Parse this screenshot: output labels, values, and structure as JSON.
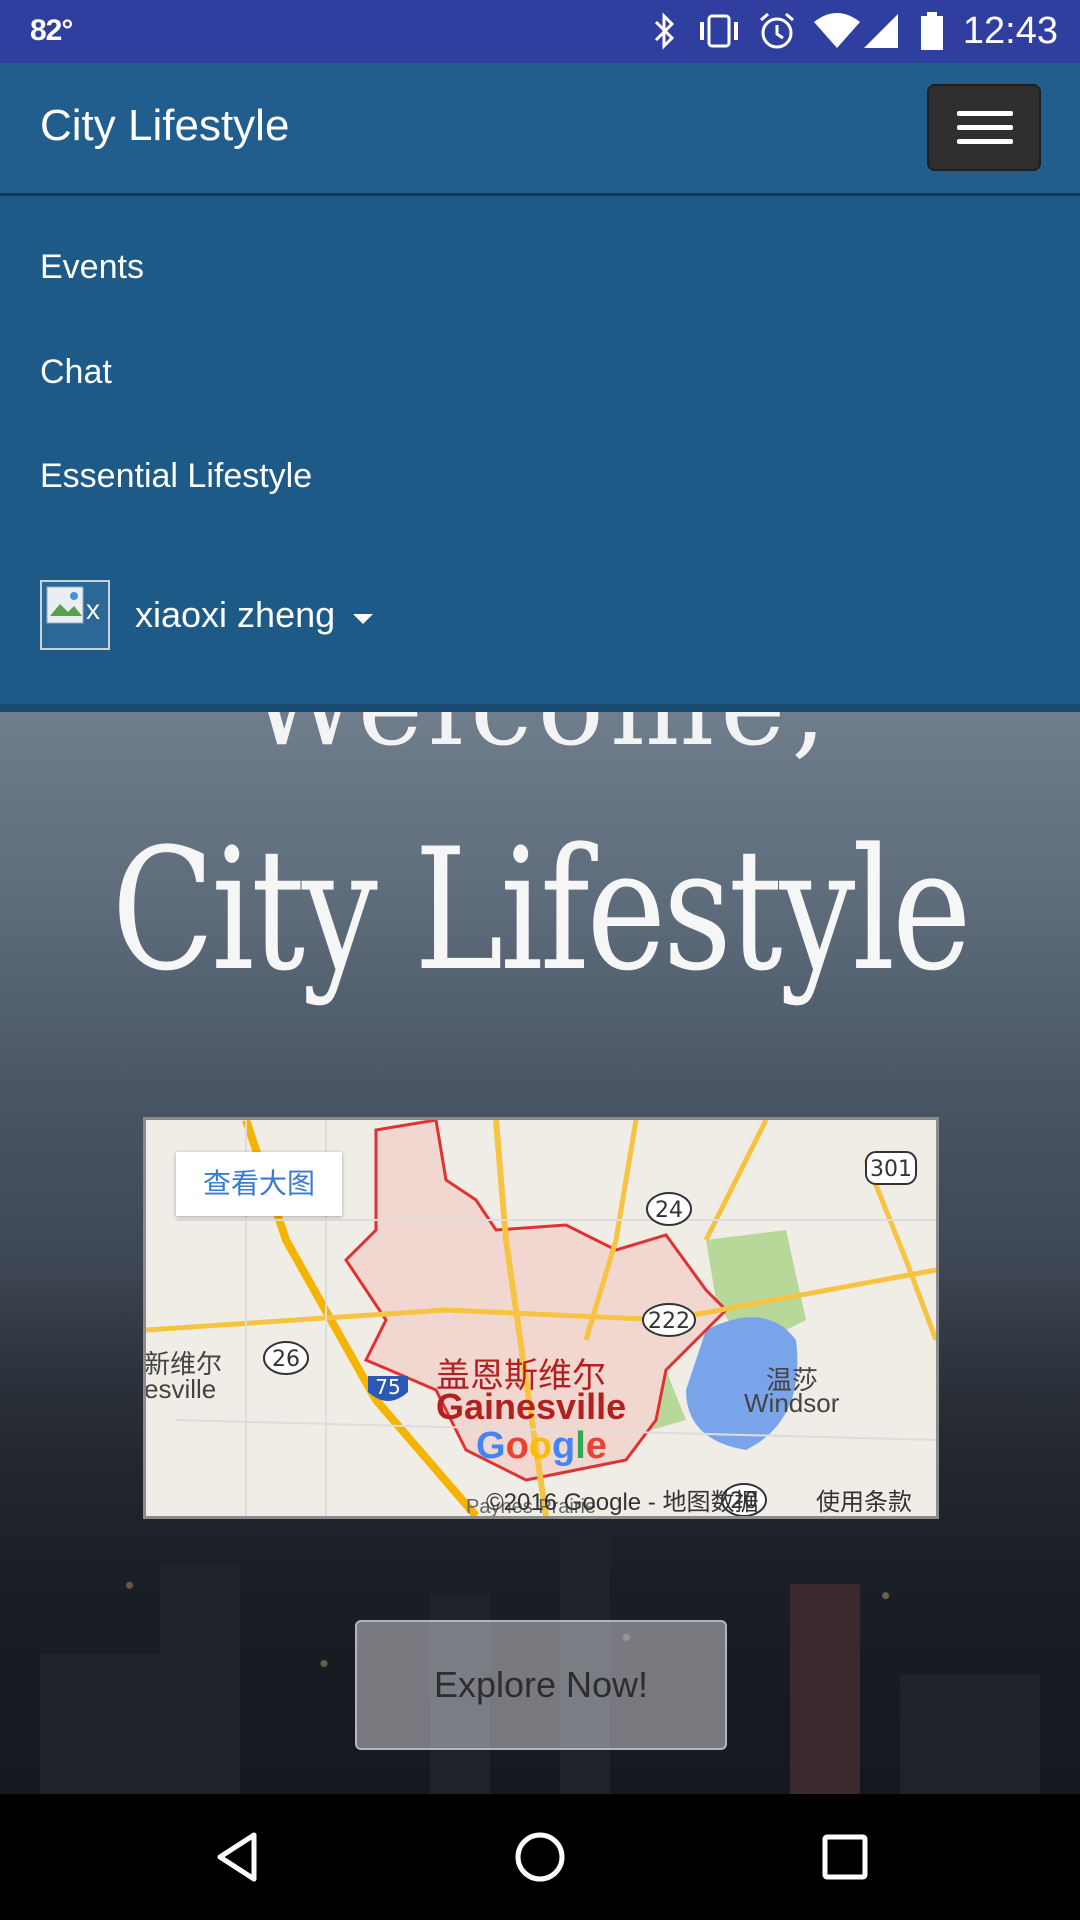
{
  "status_bar": {
    "temperature": "82°",
    "time": "12:43",
    "icons": [
      "bluetooth-icon",
      "vibrate-icon",
      "alarm-icon",
      "wifi-icon",
      "signal-icon",
      "battery-icon"
    ]
  },
  "navbar": {
    "brand": "City Lifestyle",
    "toggle_icon": "hamburger-menu-icon"
  },
  "menu": {
    "items": [
      {
        "label": "Events"
      },
      {
        "label": "Chat"
      },
      {
        "label": "Essential Lifestyle"
      }
    ],
    "user": {
      "name": "xiaoxi zheng",
      "avatar_alt": "x"
    }
  },
  "hero": {
    "title": "City Lifestyle"
  },
  "map": {
    "view_larger": "查看大图",
    "city_cn": "盖恩斯维尔",
    "city_en": "Gainesville",
    "left_cn": "新维尔",
    "left_en": "esville",
    "right_cn": "温莎",
    "right_en": "Windsor",
    "bottom_partial": "Paynes Prairie",
    "roads": [
      "301",
      "24",
      "222",
      "26",
      "75",
      "20"
    ],
    "logo": "Google",
    "copyright": "©2016 Google - 地图数据",
    "terms": "使用条款"
  },
  "explore_button": "Explore Now!",
  "colors": {
    "status_bar": "#303f9f",
    "navbar": "#215d8d",
    "menu": "#1d5a88"
  }
}
